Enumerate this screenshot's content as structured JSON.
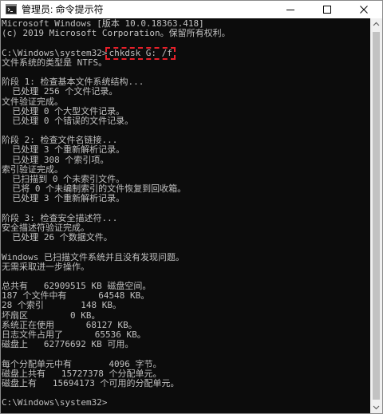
{
  "window": {
    "title": "管理员: 命令提示符"
  },
  "console": {
    "lines": [
      "Microsoft Windows [版本 10.0.18363.418]",
      "(c) 2019 Microsoft Corporation。保留所有权利。",
      "",
      "C:\\Windows\\system32>",
      "文件系统的类型是 NTFS。",
      "",
      "阶段 1: 检查基本文件系统结构...",
      "  已处理 256 个文件记录。",
      "文件验证完成。",
      "  已处理 0 个大型文件记录。",
      "  已处理 0 个错误的文件记录。",
      "",
      "阶段 2: 检查文件名链接...",
      "  已处理 3 个重新解析记录。",
      "  已处理 308 个索引项。",
      "索引验证完成。",
      "  已扫描到 0 个未索引文件。",
      "  已将 0 个未编制索引的文件恢复到回收箱。",
      "  已处理 3 个重新解析记录。",
      "",
      "阶段 3: 检查安全描述符...",
      "安全描述符验证完成。",
      "  已处理 26 个数据文件。",
      "",
      "Windows 已扫描文件系统并且没有发现问题。",
      "无需采取进一步操作。",
      "",
      "总共有   62909515 KB 磁盘空间。",
      "187 个文件中有      64548 KB。",
      "28 个索引       148 KB。",
      "坏扇区        0 KB。",
      "系统正在使用      68127 KB。",
      "日志文件占用了      65536 KB。",
      "磁盘上   62776692 KB 可用。",
      "",
      "每个分配单元中有       4096 字节。",
      "磁盘上共有   15727378 个分配单元。",
      "磁盘上有   15694173 个可用的分配单元。",
      "",
      "C:\\Windows\\system32>"
    ],
    "command": "chkdsk G: /f",
    "command_line_index": 3,
    "highlight_color": "#e8202a",
    "text_color": "#c0c0c0",
    "background_color": "#0c0c0c"
  },
  "icons": {
    "app": "cmd-icon",
    "minimize": "minimize-icon",
    "maximize": "maximize-icon",
    "close": "close-icon",
    "scroll_up": "chevron-up-icon",
    "scroll_down": "chevron-down-icon"
  }
}
